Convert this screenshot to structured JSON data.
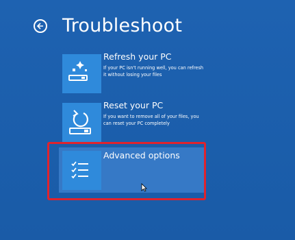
{
  "header": {
    "title": "Troubleshoot",
    "back_icon": "back-arrow-icon"
  },
  "options": [
    {
      "title": "Refresh your PC",
      "description": "If your PC isn't running well, you can refresh it without losing your files",
      "icon": "refresh-sparkle-icon"
    },
    {
      "title": "Reset your PC",
      "description": "If you want to remove all of your files, you can reset your PC completely",
      "icon": "reset-drive-icon"
    },
    {
      "title": "Advanced options",
      "description": "",
      "icon": "checklist-icon"
    }
  ],
  "colors": {
    "background": "#1c5fae",
    "tile": "#2f8adb",
    "selected": "#3679c6",
    "highlight": "#e0232d"
  }
}
